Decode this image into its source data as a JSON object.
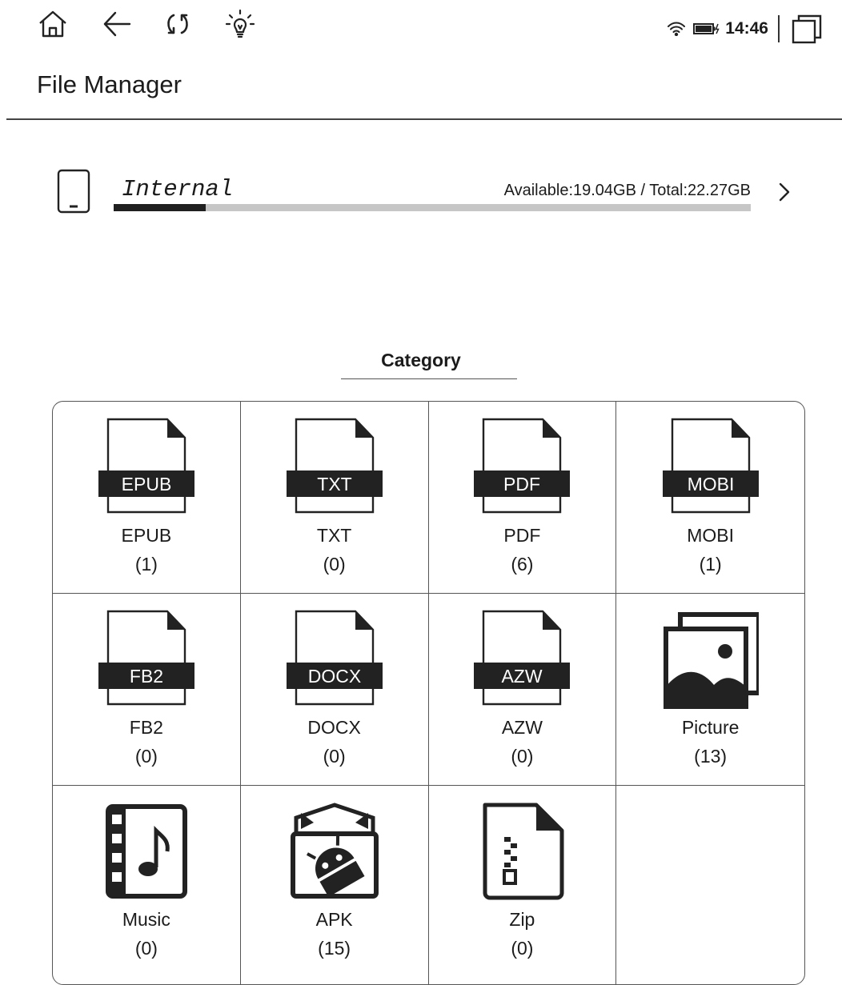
{
  "status_bar": {
    "icons": [
      "home-icon",
      "back-icon",
      "refresh-icon",
      "frontlight-icon"
    ],
    "right_icons": [
      "wifi-icon",
      "battery-charging-icon",
      "multitask-icon"
    ],
    "clock": "14:46"
  },
  "header": {
    "title": "File Manager"
  },
  "storage": {
    "name": "Internal",
    "info": "Available:19.04GB / Total:22.27GB",
    "used_fraction": 0.145,
    "icon": "tablet-icon"
  },
  "category": {
    "label": "Category",
    "items": [
      {
        "label": "EPUB",
        "count": "(1)",
        "badge": "EPUB",
        "icon": "epub-file-icon"
      },
      {
        "label": "TXT",
        "count": "(0)",
        "badge": "TXT",
        "icon": "txt-file-icon"
      },
      {
        "label": "PDF",
        "count": "(6)",
        "badge": "PDF",
        "icon": "pdf-file-icon"
      },
      {
        "label": "MOBI",
        "count": "(1)",
        "badge": "MOBI",
        "icon": "mobi-file-icon"
      },
      {
        "label": "FB2",
        "count": "(0)",
        "badge": "FB2",
        "icon": "fb2-file-icon"
      },
      {
        "label": "DOCX",
        "count": "(0)",
        "badge": "DOCX",
        "icon": "docx-file-icon"
      },
      {
        "label": "AZW",
        "count": "(0)",
        "badge": "AZW",
        "icon": "azw-file-icon"
      },
      {
        "label": "Picture",
        "count": "(13)",
        "icon": "picture-icon"
      },
      {
        "label": "Music",
        "count": "(0)",
        "icon": "music-icon"
      },
      {
        "label": "APK",
        "count": "(15)",
        "icon": "apk-icon"
      },
      {
        "label": "Zip",
        "count": "(0)",
        "icon": "zip-icon"
      }
    ]
  }
}
